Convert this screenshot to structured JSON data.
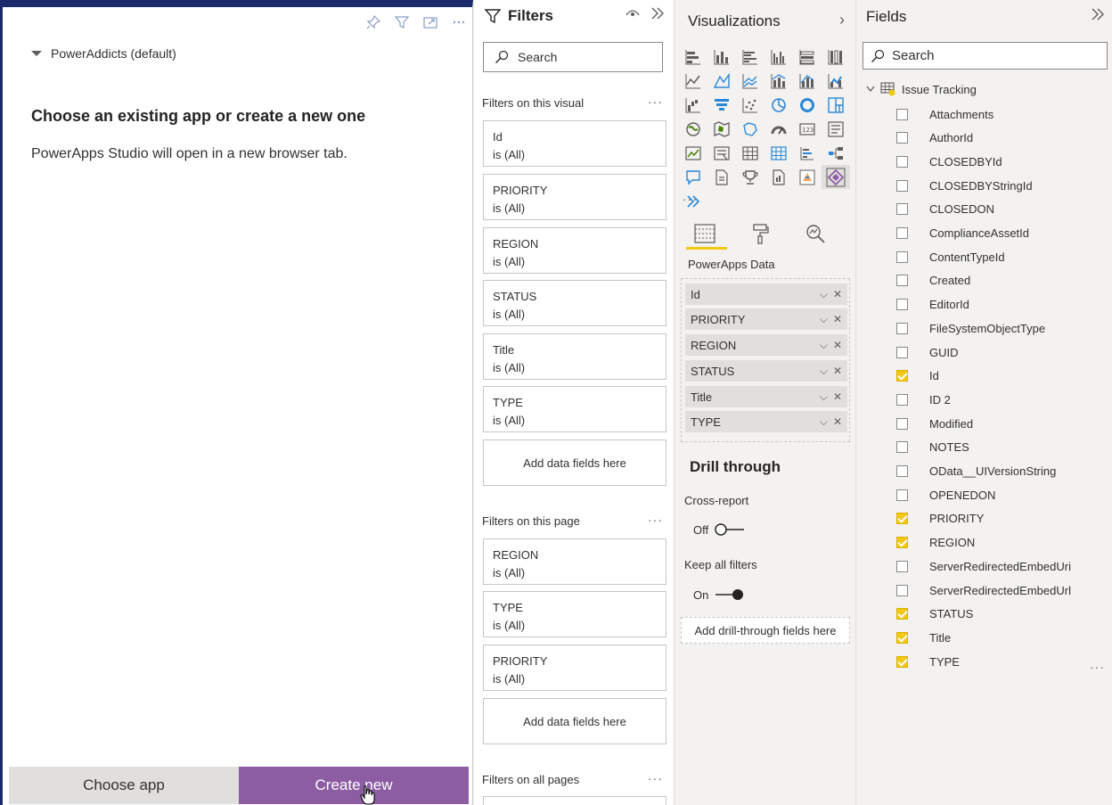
{
  "visual": {
    "environment": "PowerAddicts (default)",
    "title": "Choose an existing app or create a new one",
    "subtitle": "PowerApps Studio will open in a new browser tab.",
    "choose_app_label": "Choose app",
    "create_new_label": "Create new"
  },
  "filters": {
    "title": "Filters",
    "search_placeholder": "Search",
    "on_visual_label": "Filters on this visual",
    "on_visual": [
      {
        "name": "Id",
        "state": "is (All)"
      },
      {
        "name": "PRIORITY",
        "state": "is (All)"
      },
      {
        "name": "REGION",
        "state": "is (All)"
      },
      {
        "name": "STATUS",
        "state": "is (All)"
      },
      {
        "name": "Title",
        "state": "is (All)"
      },
      {
        "name": "TYPE",
        "state": "is (All)"
      }
    ],
    "add_fields_label": "Add data fields here",
    "on_page_label": "Filters on this page",
    "on_page": [
      {
        "name": "REGION",
        "state": "is (All)"
      },
      {
        "name": "TYPE",
        "state": "is (All)"
      },
      {
        "name": "PRIORITY",
        "state": "is (All)"
      }
    ],
    "on_all_pages_label": "Filters on all pages"
  },
  "visualizations": {
    "title": "Visualizations",
    "more": "...",
    "well_label": "PowerApps Data",
    "well_items": [
      "Id",
      "PRIORITY",
      "REGION",
      "STATUS",
      "Title",
      "TYPE"
    ],
    "drill_title": "Drill through",
    "cross_report_label": "Cross-report",
    "cross_report_state": "Off",
    "keep_filters_label": "Keep all filters",
    "keep_filters_state": "On",
    "drill_drop_label": "Add drill-through fields here"
  },
  "fields": {
    "title": "Fields",
    "search_placeholder": "Search",
    "table_name": "Issue Tracking",
    "items": [
      {
        "name": "Attachments",
        "checked": false
      },
      {
        "name": "AuthorId",
        "checked": false
      },
      {
        "name": "CLOSEDBYId",
        "checked": false
      },
      {
        "name": "CLOSEDBYStringId",
        "checked": false
      },
      {
        "name": "CLOSEDON",
        "checked": false
      },
      {
        "name": "ComplianceAssetId",
        "checked": false
      },
      {
        "name": "ContentTypeId",
        "checked": false
      },
      {
        "name": "Created",
        "checked": false
      },
      {
        "name": "EditorId",
        "checked": false
      },
      {
        "name": "FileSystemObjectType",
        "checked": false
      },
      {
        "name": "GUID",
        "checked": false
      },
      {
        "name": "Id",
        "checked": true
      },
      {
        "name": "ID 2",
        "checked": false
      },
      {
        "name": "Modified",
        "checked": false
      },
      {
        "name": "NOTES",
        "checked": false
      },
      {
        "name": "OData__UIVersionString",
        "checked": false
      },
      {
        "name": "OPENEDON",
        "checked": false
      },
      {
        "name": "PRIORITY",
        "checked": true
      },
      {
        "name": "REGION",
        "checked": true
      },
      {
        "name": "ServerRedirectedEmbedUri",
        "checked": false
      },
      {
        "name": "ServerRedirectedEmbedUrl",
        "checked": false
      },
      {
        "name": "STATUS",
        "checked": true
      },
      {
        "name": "Title",
        "checked": true
      },
      {
        "name": "TYPE",
        "checked": true
      }
    ]
  },
  "colors": {
    "accent": "#f2c811",
    "create_button": "#8d5da3",
    "frame": "#1b2a6b"
  }
}
